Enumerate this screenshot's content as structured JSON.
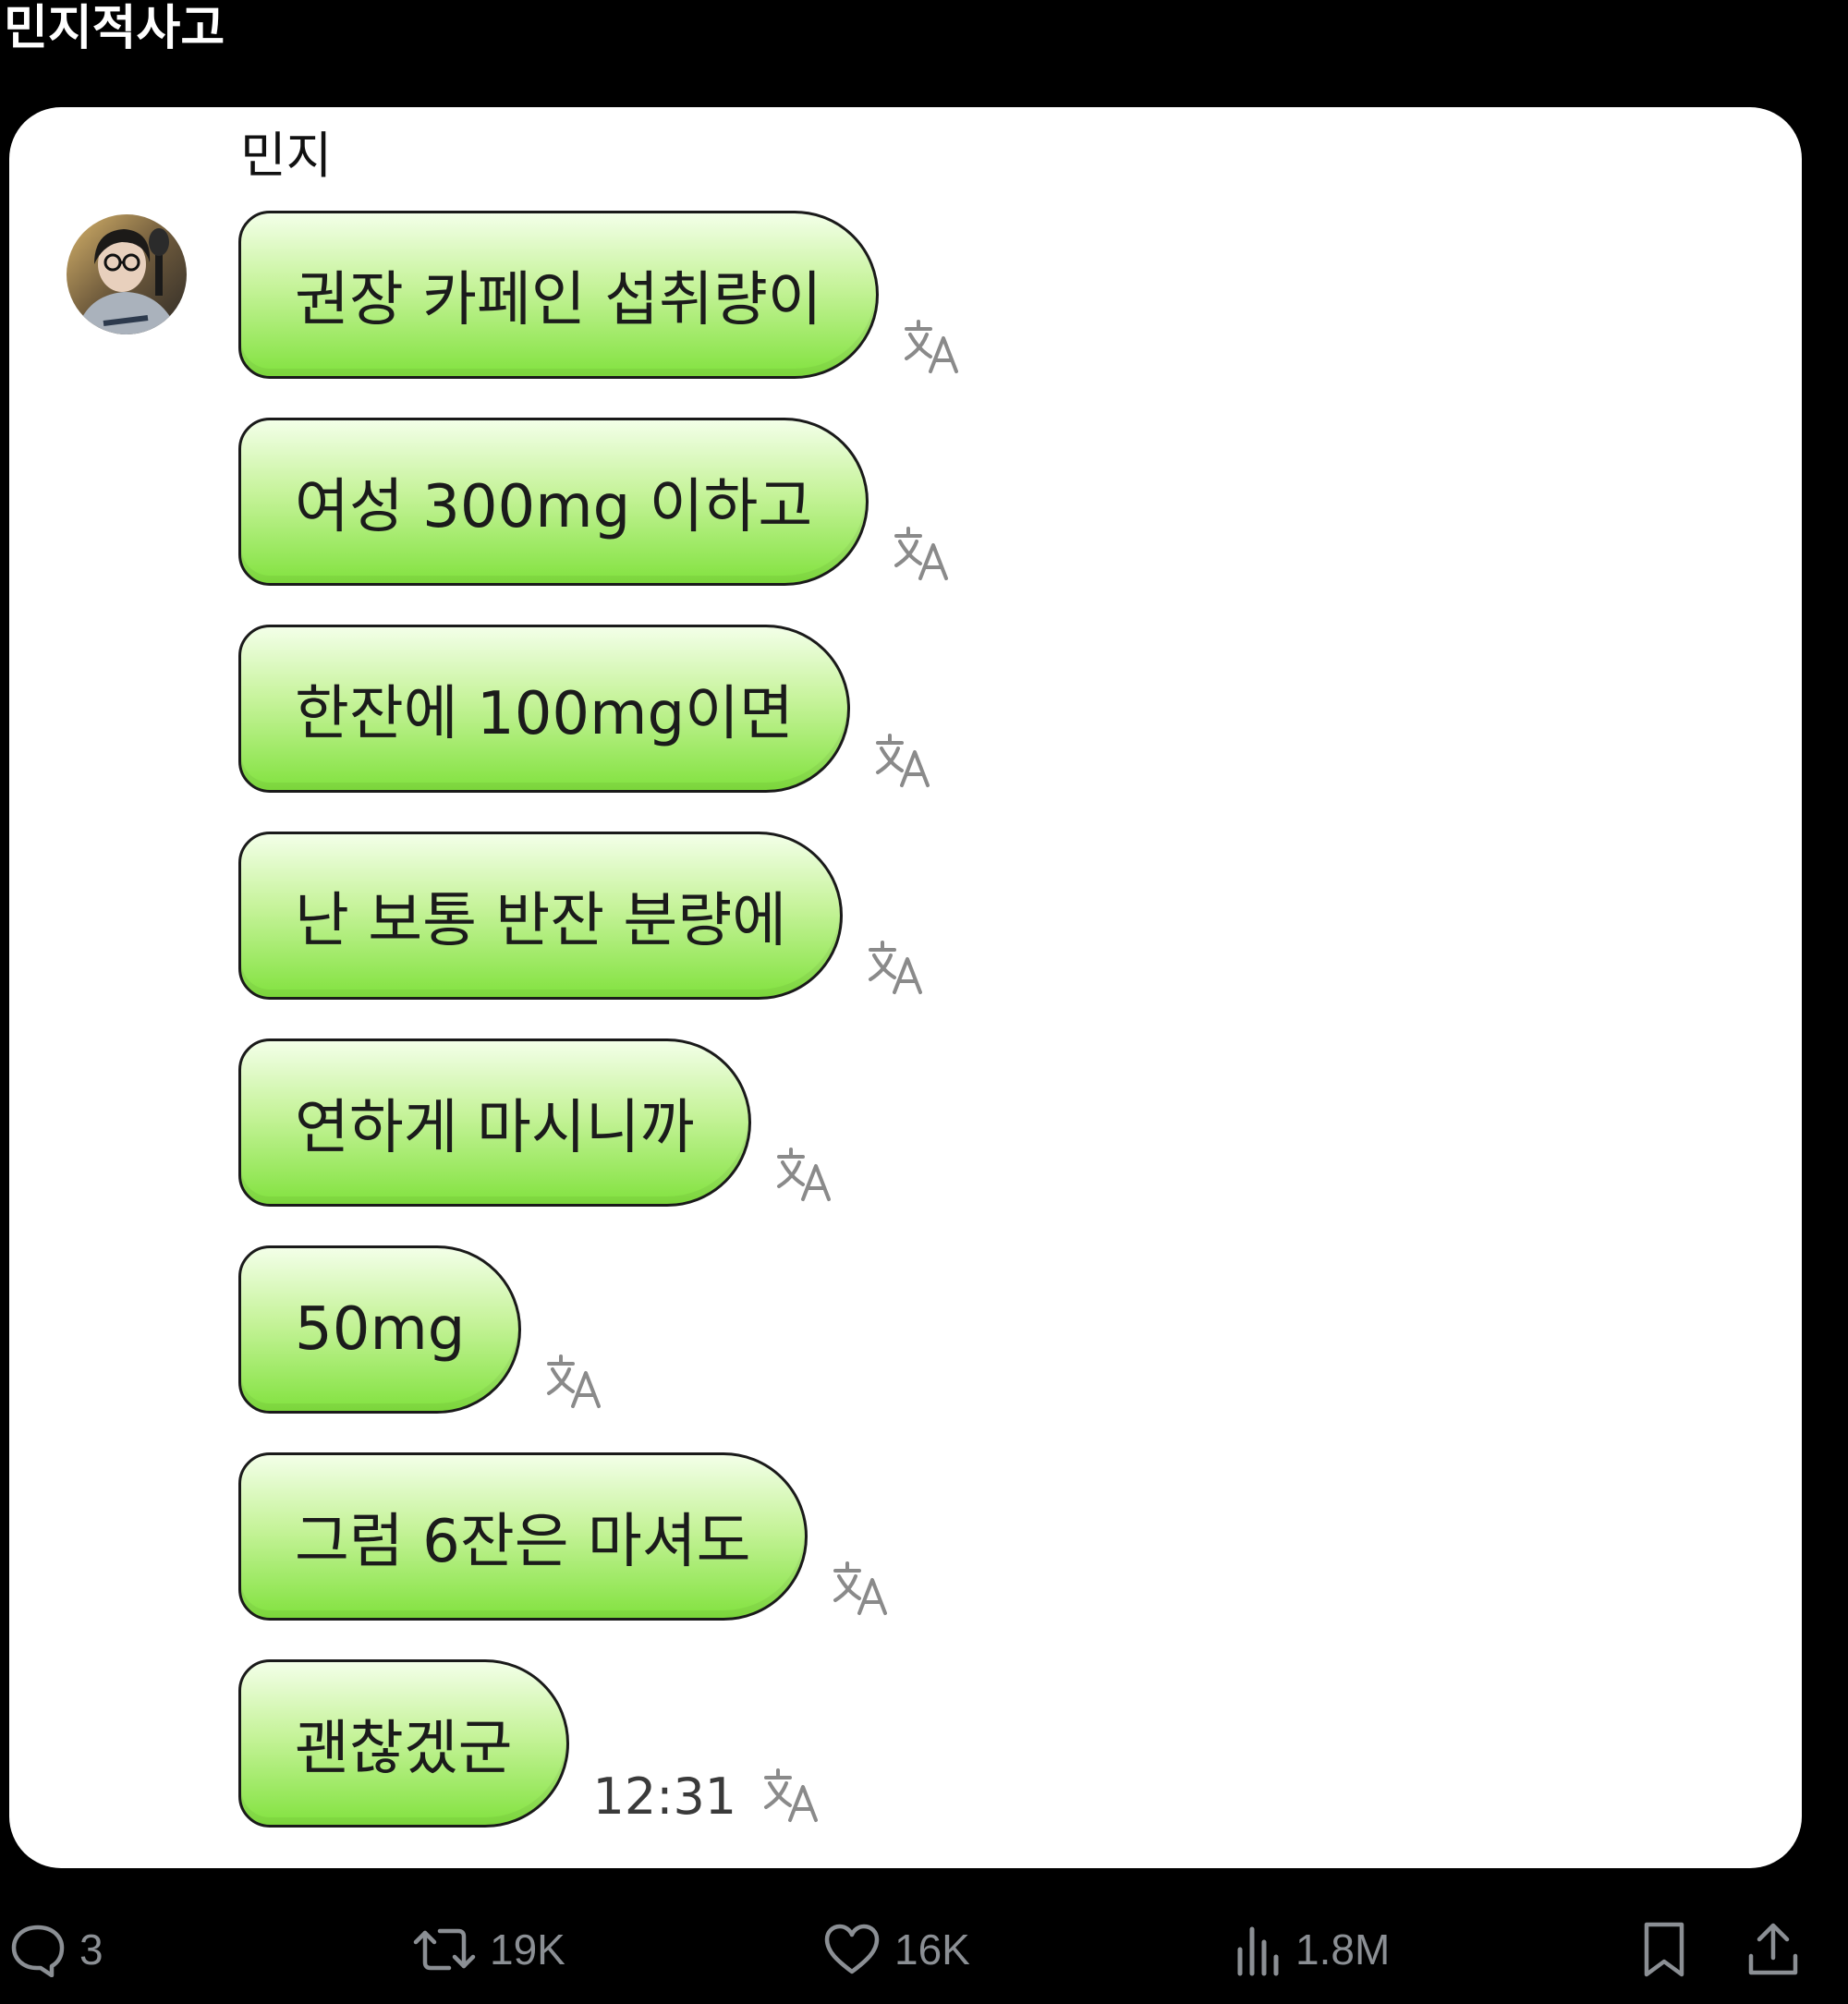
{
  "post": {
    "title": "민지적사고"
  },
  "chat": {
    "sender_name": "민지",
    "avatar": "profile-photo",
    "translate_icon": "translate-icon",
    "bubble_colors": {
      "top": "#f3ffe8",
      "bottom": "#82e23f",
      "border": "#1a1a1a"
    },
    "messages": [
      {
        "text": "권장 카페인 섭취량이"
      },
      {
        "text": "여성 300mg 이하고"
      },
      {
        "text": "한잔에 100mg이면"
      },
      {
        "text": "난 보통 반잔 분량에"
      },
      {
        "text": "연하게 마시니까"
      },
      {
        "text": "50mg"
      },
      {
        "text": "그럼 6잔은 마셔도"
      },
      {
        "text": "괜찮겠군",
        "time": "12:31"
      }
    ]
  },
  "actions": {
    "replies": {
      "icon": "reply-icon",
      "count": "3"
    },
    "reposts": {
      "icon": "repost-icon",
      "count": "19K"
    },
    "likes": {
      "icon": "heart-icon",
      "count": "16K"
    },
    "views": {
      "icon": "views-icon",
      "count": "1.8M"
    },
    "bookmark": {
      "icon": "bookmark-icon"
    },
    "share": {
      "icon": "share-icon"
    }
  }
}
